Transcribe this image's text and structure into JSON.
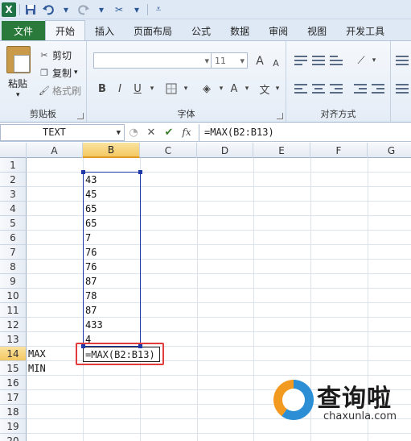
{
  "qat": {
    "logo": "X",
    "icons": [
      "excel-logo",
      "save-icon",
      "undo-icon",
      "redo-icon",
      "format-painter-icon",
      "customize-icon"
    ]
  },
  "tabs": [
    {
      "label": "文件"
    },
    {
      "label": "开始"
    },
    {
      "label": "插入"
    },
    {
      "label": "页面布局"
    },
    {
      "label": "公式"
    },
    {
      "label": "数据"
    },
    {
      "label": "审阅"
    },
    {
      "label": "视图"
    },
    {
      "label": "开发工具"
    }
  ],
  "ribbon": {
    "clipboard": {
      "paste": "粘贴",
      "cut": "剪切",
      "copy": "复制",
      "format_painter": "格式刷",
      "group_label": "剪贴板"
    },
    "font": {
      "size": "11",
      "bold": "B",
      "italic": "I",
      "underline": "U",
      "grow": "A",
      "shrink": "A",
      "color": "A",
      "group_label": "字体"
    },
    "alignment": {
      "group_label": "对齐方式"
    }
  },
  "formula_bar": {
    "name_box": "TEXT",
    "cancel": "✕",
    "enter": "✔",
    "fx": "fx",
    "formula": "=MAX(B2:B13)"
  },
  "sheet": {
    "columns": [
      "A",
      "B",
      "C",
      "D",
      "E",
      "F",
      "G"
    ],
    "selected_column": "B",
    "rows": [
      "1",
      "2",
      "3",
      "4",
      "5",
      "6",
      "7",
      "8",
      "9",
      "10",
      "11",
      "12",
      "13",
      "14",
      "15",
      "16",
      "17",
      "18",
      "19",
      "20"
    ],
    "selected_row": "14",
    "b_values": [
      "43",
      "45",
      "65",
      "65",
      "7",
      "76",
      "76",
      "87",
      "78",
      "87",
      "433",
      "4"
    ],
    "a14": "MAX",
    "a15": "MIN",
    "b14_edit": "=MAX(B2:B13)"
  },
  "watermark": {
    "cn": "查询啦",
    "en": "chaxunla.com"
  },
  "colors": {
    "file_tab": "#2a7a3b",
    "range_border": "#1f3aa8",
    "highlight_box": "#e23b3b",
    "selected_header": "#f3c862"
  }
}
